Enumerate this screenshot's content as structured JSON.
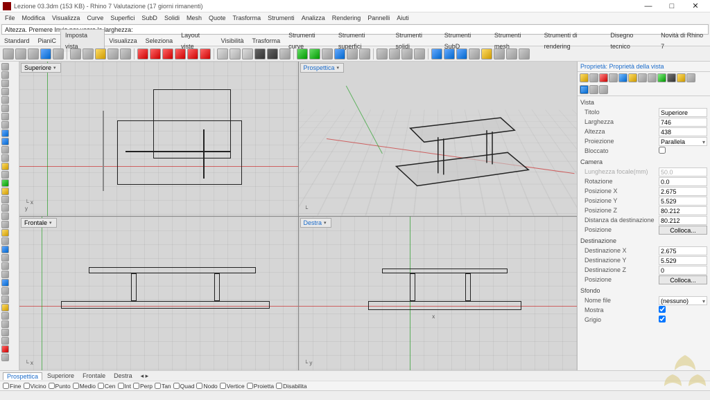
{
  "titlebar": {
    "icon": "rhino-icon",
    "title": "Lezione 03.3dm (153 KB) - Rhino 7 Valutazione (17 giorni rimanenti)"
  },
  "winbtns": {
    "min": "—",
    "max": "□",
    "close": "✕"
  },
  "menu": [
    "File",
    "Modifica",
    "Visualizza",
    "Curve",
    "Superfici",
    "SubD",
    "Solidi",
    "Mesh",
    "Quote",
    "Trasforma",
    "Strumenti",
    "Analizza",
    "Rendering",
    "Pannelli",
    "Aiuti"
  ],
  "command_line": "Altezza. Premere Invio per usare la larghezza:",
  "toolbar_tabs": [
    "Standard",
    "PianiC",
    "Imposta vista",
    "Visualizza",
    "Seleziona",
    "Layout viste",
    "Visibilità",
    "Trasforma",
    "Strumenti curve",
    "Strumenti superfici",
    "Strumenti solidi",
    "Strumenti SubD",
    "Strumenti mesh",
    "Strumenti di rendering",
    "Disegno tecnico",
    "Novità di Rhino 7"
  ],
  "viewports": {
    "tl": {
      "name": "Superiore"
    },
    "tr": {
      "name": "Prospettica"
    },
    "bl": {
      "name": "Frontale"
    },
    "br": {
      "name": "Destra"
    }
  },
  "properties": {
    "header": "Proprietà: Proprietà della vista",
    "groups": {
      "vista": {
        "label": "Vista",
        "titolo": {
          "lbl": "Titolo",
          "val": "Superiore"
        },
        "largh": {
          "lbl": "Larghezza",
          "val": "746"
        },
        "alt": {
          "lbl": "Altezza",
          "val": "438"
        },
        "proj": {
          "lbl": "Proiezione",
          "val": "Parallela"
        },
        "block": {
          "lbl": "Bloccato"
        }
      },
      "camera": {
        "label": "Camera",
        "foc": {
          "lbl": "Lunghezza focale(mm)",
          "val": "50.0"
        },
        "rot": {
          "lbl": "Rotazione",
          "val": "0.0"
        },
        "px": {
          "lbl": "Posizione X",
          "val": "2.675"
        },
        "py": {
          "lbl": "Posizione Y",
          "val": "5.529"
        },
        "pz": {
          "lbl": "Posizione Z",
          "val": "80.212"
        },
        "dist": {
          "lbl": "Distanza da destinazione",
          "val": "80.212"
        },
        "pos": {
          "lbl": "Posizione",
          "btn": "Colloca..."
        }
      },
      "dest": {
        "label": "Destinazione",
        "dx": {
          "lbl": "Destinazione X",
          "val": "2.675"
        },
        "dy": {
          "lbl": "Destinazione Y",
          "val": "5.529"
        },
        "dz": {
          "lbl": "Destinazione Z",
          "val": "0"
        },
        "pos": {
          "lbl": "Posizione",
          "btn": "Colloca..."
        }
      },
      "sfondo": {
        "label": "Sfondo",
        "file": {
          "lbl": "Nome file",
          "val": "(nessuno)"
        },
        "show": {
          "lbl": "Mostra"
        },
        "grey": {
          "lbl": "Grigio"
        }
      }
    }
  },
  "bottom_tabs": [
    "Prospettica",
    "Superiore",
    "Frontale",
    "Destra"
  ],
  "bottom_tabs_arrows": "◂ ▸",
  "osnap": [
    "Fine",
    "Vicino",
    "Punto",
    "Medio",
    "Cen",
    "Int",
    "Perp",
    "Tan",
    "Quad",
    "Nodo",
    "Vertice",
    "Proietta",
    "Disabilita"
  ],
  "status": [
    "",
    ""
  ]
}
